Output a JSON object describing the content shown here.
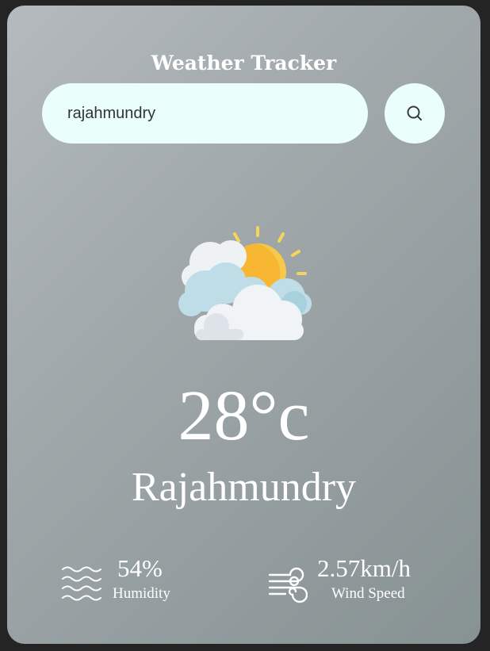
{
  "app": {
    "title": "Weather Tracker"
  },
  "search": {
    "value": "rajahmundry",
    "button_icon": "search-icon"
  },
  "weather": {
    "icon": "partly-cloudy-sun-icon",
    "temperature": "28°c",
    "city": "Rajahmundry"
  },
  "details": {
    "humidity": {
      "icon": "humidity-waves-icon",
      "value": "54%",
      "label": "Humidity"
    },
    "wind": {
      "icon": "wind-icon",
      "value": "2.57km/h",
      "label": "Wind Speed"
    }
  },
  "colors": {
    "card_gradient_start": "#b4babe",
    "card_gradient_end": "#879293",
    "input_background": "#eafffb",
    "text": "#ffffff",
    "sun": "#f7b733"
  }
}
